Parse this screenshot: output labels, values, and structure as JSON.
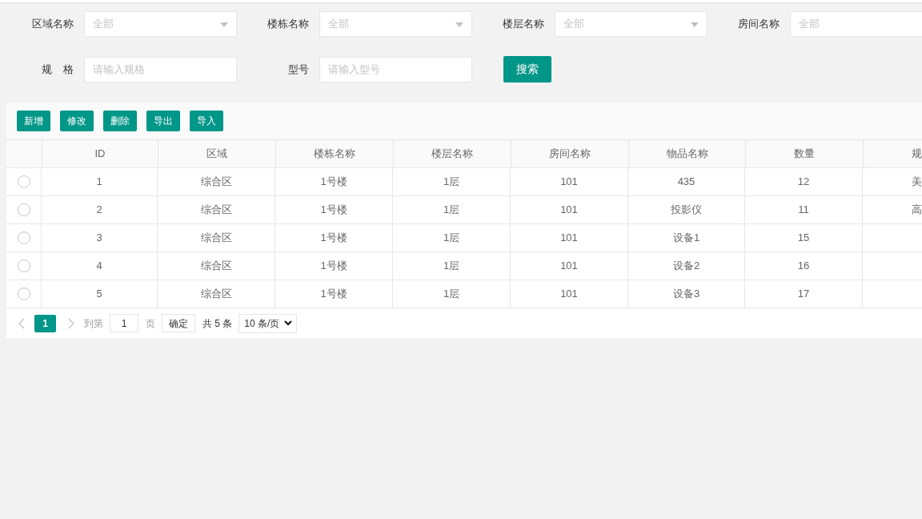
{
  "filter_rows": [
    [
      {
        "label": "区域名称",
        "kind": "select",
        "placeholder": "全部"
      },
      {
        "label": "楼栋名称",
        "kind": "select",
        "placeholder": "全部"
      },
      {
        "label": "楼层名称",
        "kind": "select",
        "placeholder": "全部"
      },
      {
        "label": "房间名称",
        "kind": "select",
        "placeholder": "全部"
      }
    ],
    [
      {
        "label": "规    格",
        "kind": "input",
        "placeholder": "请输入规格"
      },
      {
        "label": "型号",
        "kind": "input",
        "placeholder": "请输入型号"
      }
    ]
  ],
  "search_button": "搜索",
  "toolbar": [
    "新增",
    "修改",
    "删除",
    "导出",
    "导入"
  ],
  "table": {
    "columns": [
      "ID",
      "区域",
      "楼栋名称",
      "楼层名称",
      "房间名称",
      "物品名称",
      "数量",
      "规"
    ],
    "rows": [
      {
        "selected": false,
        "cells": [
          "1",
          "综合区",
          "1号楼",
          "1层",
          "101",
          "435",
          "12",
          "美"
        ]
      },
      {
        "selected": false,
        "cells": [
          "2",
          "综合区",
          "1号楼",
          "1层",
          "101",
          "投影仪",
          "11",
          "高"
        ]
      },
      {
        "selected": false,
        "cells": [
          "3",
          "综合区",
          "1号楼",
          "1层",
          "101",
          "设备1",
          "15"
        ]
      },
      {
        "selected": false,
        "cells": [
          "4",
          "综合区",
          "1号楼",
          "1层",
          "101",
          "设备2",
          "16"
        ]
      },
      {
        "selected": false,
        "cells": [
          "5",
          "综合区",
          "1号楼",
          "1层",
          "101",
          "设备3",
          "17"
        ]
      }
    ]
  },
  "pagination": {
    "prev": {
      "disabled": true
    },
    "pages": [
      {
        "label": "1",
        "selected": true
      }
    ],
    "next": {
      "disabled": true
    },
    "goto_label": "到第",
    "goto_value": "1",
    "page_label": "页",
    "confirm": "确定",
    "total": "共 5 条",
    "page_size": "10 条/页"
  }
}
